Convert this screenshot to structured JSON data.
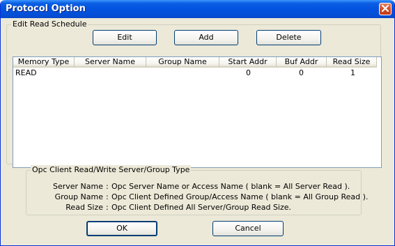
{
  "window": {
    "title": "Protocol Option"
  },
  "edit_group": {
    "legend": "Edit Read Schedule",
    "edit_label": "Edit",
    "add_label": "Add",
    "delete_label": "Delete"
  },
  "list": {
    "columns": [
      "Memory Type",
      "Server Name",
      "Group Name",
      "Start Addr",
      "Buf Addr",
      "Read Size"
    ],
    "rows": [
      {
        "memory_type": "READ",
        "server_name": "",
        "group_name": "",
        "start_addr": "0",
        "buf_addr": "0",
        "read_size": "1"
      }
    ]
  },
  "info_group": {
    "legend": "Opc Client Read/Write Server/Group Type",
    "lines": [
      {
        "label": "Server Name",
        "sep": ":",
        "desc": "Opc Server Name or Access Name ( blank = All Server Read )."
      },
      {
        "label": "Group Name",
        "sep": ":",
        "desc": "Opc Client Defined Group/Access Name ( blank = All Group Read )."
      },
      {
        "label": "Read Size",
        "sep": ":",
        "desc": "Opc Client Defined All Server/Group Read Size."
      }
    ]
  },
  "footer": {
    "ok_label": "OK",
    "cancel_label": "Cancel"
  },
  "colors": {
    "title_bar": "#0453e0",
    "dialog_bg": "#ece9d8",
    "close_button": "#d6512e",
    "button_border": "#003c74"
  },
  "icons": {
    "close": "close-icon"
  }
}
